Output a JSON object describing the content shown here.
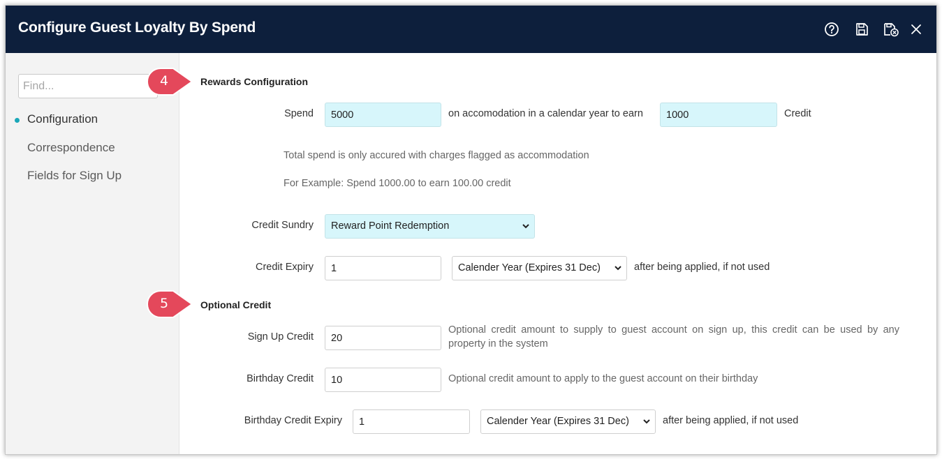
{
  "window": {
    "title": "Configure Guest Loyalty By Spend",
    "icons": [
      "help-icon",
      "save-icon",
      "save-close-icon",
      "close-icon"
    ]
  },
  "sidebar": {
    "find_placeholder": "Find...",
    "items": [
      {
        "label": "Configuration",
        "active": true
      },
      {
        "label": "Correspondence",
        "active": false
      },
      {
        "label": "Fields for Sign Up",
        "active": false
      }
    ]
  },
  "markers": [
    "4",
    "5"
  ],
  "rewards": {
    "title": "Rewards Configuration",
    "spend_label": "Spend",
    "spend_value": "5000",
    "spend_mid_text": "on accomodation in a calendar year to earn",
    "earn_value": "1000",
    "credit_suffix": "Credit",
    "help1": "Total spend is only accured with charges flagged as accommodation",
    "help2": "For Example: Spend 1000.00 to earn 100.00 credit",
    "sundry_label": "Credit Sundry",
    "sundry_value": "Reward Point Redemption",
    "expiry_label": "Credit Expiry",
    "expiry_value": "1",
    "expiry_unit": "Calender Year (Expires 31 Dec)",
    "expiry_suffix": "after being applied, if not used"
  },
  "optional": {
    "title": "Optional Credit",
    "signup_label": "Sign Up Credit",
    "signup_value": "20",
    "signup_help_line1": "Optional credit amount to supply to guest account on sign up, this credit can be used by any",
    "signup_help_line2": "property in the system",
    "birthday_label": "Birthday Credit",
    "birthday_value": "10",
    "birthday_help": "Optional credit amount to apply to the guest account on their birthday",
    "bexpiry_label": "Birthday Credit Expiry",
    "bexpiry_value": "1",
    "bexpiry_unit": "Calender Year (Expires 31 Dec)",
    "bexpiry_suffix": "after being applied, if not used"
  },
  "colors": {
    "titlebar": "#0d1f3c",
    "accent": "#1aa7b8",
    "field_highlight": "#d7f6fb",
    "marker": "#e4485b"
  }
}
